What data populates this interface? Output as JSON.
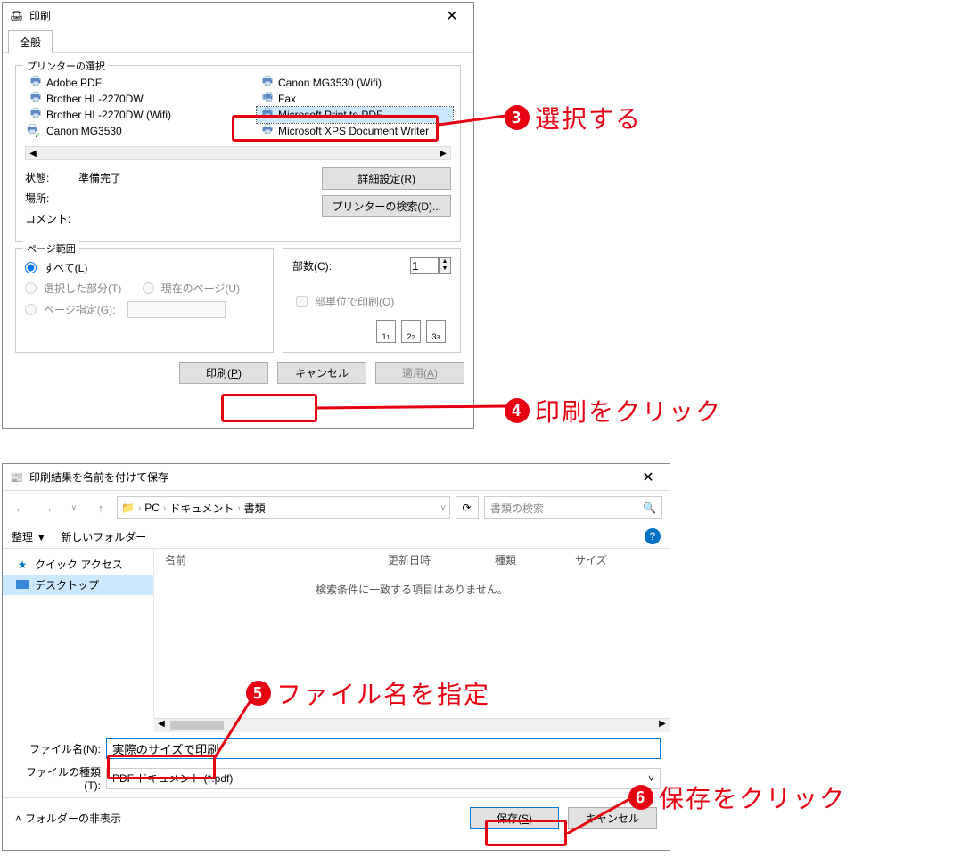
{
  "print_dialog": {
    "title": "印刷",
    "tab_general": "全般",
    "printer_group": "プリンターの選択",
    "printers": [
      {
        "name": "Adobe PDF"
      },
      {
        "name": "Brother HL-2270DW"
      },
      {
        "name": "Brother HL-2270DW (Wifi)"
      },
      {
        "name": "Canon MG3530",
        "default": true
      },
      {
        "name": "Canon MG3530 (Wifi)"
      },
      {
        "name": "Fax"
      },
      {
        "name": "Microsoft Print to PDF",
        "selected": true
      },
      {
        "name": "Microsoft XPS Document Writer"
      }
    ],
    "status_label": "状態:",
    "status_value": "準備完了",
    "location_label": "場所:",
    "comment_label": "コメント:",
    "pref_btn": "詳細設定(R)",
    "find_btn": "プリンターの検索(D)...",
    "range_group": "ページ範囲",
    "range_all": "すべて(L)",
    "range_selection": "選択した部分(T)",
    "range_current": "現在のページ(U)",
    "range_pages": "ページ指定(G):",
    "copies_label": "部数(C):",
    "copies_value": "1",
    "collate_label": "部単位で印刷(O)",
    "collate1": "1",
    "collate2": "2",
    "collate3": "3",
    "print_btn": "印刷(P)",
    "cancel_btn": "キャンセル",
    "apply_btn": "適用(A)"
  },
  "save_dialog": {
    "title": "印刷結果を名前を付けて保存",
    "path_seg1": "PC",
    "path_seg2": "ドキュメント",
    "path_seg3": "書類",
    "search_placeholder": "書類の検索",
    "organize": "整理 ▼",
    "new_folder": "新しいフォルダー",
    "side_quick": "クイック アクセス",
    "side_desktop": "デスクトップ",
    "col_name": "名前",
    "col_date": "更新日時",
    "col_type": "種類",
    "col_size": "サイズ",
    "empty": "検索条件に一致する項目はありません。",
    "filename_label": "ファイル名(N):",
    "filename_value": "実際のサイズで印刷",
    "filetype_label": "ファイルの種類(T):",
    "filetype_value": "PDF ドキュメント (*.pdf)",
    "hide_folders": "フォルダーの非表示",
    "save_btn": "保存(S)",
    "cancel_btn": "キャンセル"
  },
  "annotations": {
    "step3": "選択する",
    "step4": "印刷をクリック",
    "step5": "ファイル名を指定",
    "step6": "保存をクリック"
  }
}
